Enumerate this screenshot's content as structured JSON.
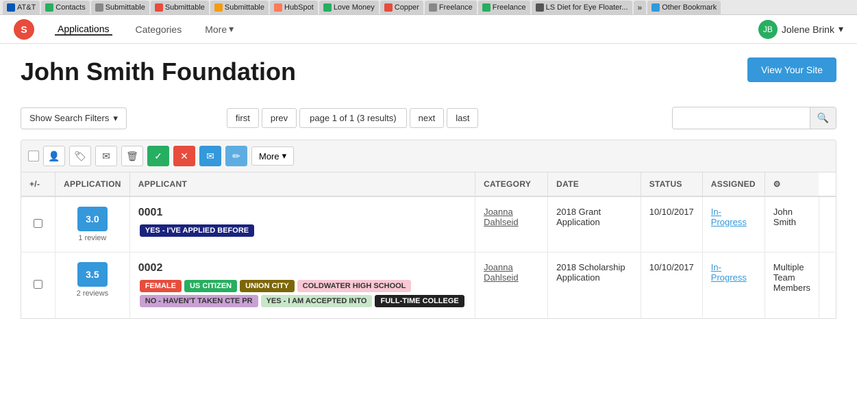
{
  "browser": {
    "tabs": [
      {
        "id": "att",
        "label": "AT&T",
        "icon_color": "#0057b7",
        "icon_char": "A"
      },
      {
        "id": "contacts",
        "label": "Contacts",
        "icon_color": "#27ae60",
        "icon_char": "C"
      },
      {
        "id": "submittable1",
        "label": "Submittable",
        "icon_color": "#888",
        "icon_char": "S"
      },
      {
        "id": "submittable2",
        "label": "Submittable",
        "icon_color": "#e74c3c",
        "icon_char": "S"
      },
      {
        "id": "submittable3",
        "label": "Submittable",
        "icon_color": "#f39c12",
        "icon_char": "S"
      },
      {
        "id": "hubspot",
        "label": "HubSpot",
        "icon_color": "#ff7a59",
        "icon_char": "H"
      },
      {
        "id": "lovemoney",
        "label": "Love Money",
        "icon_color": "#27ae60",
        "icon_char": "L"
      },
      {
        "id": "copper",
        "label": "Copper",
        "icon_color": "#e74c3c",
        "icon_char": "C"
      },
      {
        "id": "freelance1",
        "label": "Freelance",
        "icon_color": "#888",
        "icon_char": "F"
      },
      {
        "id": "freelance2",
        "label": "Freelance",
        "icon_color": "#27ae60",
        "icon_char": "F"
      },
      {
        "id": "diet",
        "label": "LS Diet for Eye Floater...",
        "icon_color": "#555",
        "icon_char": "L"
      },
      {
        "id": "other",
        "label": "Other Bookmark",
        "icon_color": "#3498db",
        "icon_char": "O"
      }
    ],
    "more_tabs_label": "»"
  },
  "nav": {
    "logo_char": "S",
    "links": [
      {
        "id": "applications",
        "label": "Applications",
        "active": true
      },
      {
        "id": "categories",
        "label": "Categories",
        "active": false
      }
    ],
    "more_label": "More",
    "user_name": "Jolene Brink",
    "user_initials": "JB"
  },
  "header": {
    "title": "John Smith Foundation",
    "view_site_btn": "View Your Site"
  },
  "filter_bar": {
    "show_filters_label": "Show Search Filters",
    "pagination": {
      "first": "first",
      "prev": "prev",
      "info": "page 1 of 1 (3 results)",
      "next": "next",
      "last": "last"
    },
    "search_placeholder": ""
  },
  "toolbar": {
    "more_label": "More",
    "chevron": "▾"
  },
  "table": {
    "columns": {
      "adjust": "+/-",
      "application": "APPLICATION",
      "applicant": "APPLICANT",
      "category": "CATEGORY",
      "date": "DATE",
      "status": "STATUS",
      "assigned": "ASSIGNED"
    },
    "rows": [
      {
        "id": "row-0001",
        "score": "3.0",
        "review_count": "1 review",
        "app_number": "0001",
        "applicant": "Joanna Dahlseid",
        "category": "2018 Grant Application",
        "date": "10/10/2017",
        "status": "In-Progress",
        "assigned": "John Smith",
        "tags": [
          {
            "label": "YES - I'VE APPLIED BEFORE",
            "color": "#1a237e"
          }
        ]
      },
      {
        "id": "row-0002",
        "score": "3.5",
        "review_count": "2 reviews",
        "app_number": "0002",
        "applicant": "Joanna Dahlseid",
        "category": "2018 Scholarship Application",
        "date": "10/10/2017",
        "status": "In-Progress",
        "assigned": "Multiple Team Members",
        "tags": [
          {
            "label": "FEMALE",
            "color": "#e74c3c"
          },
          {
            "label": "US CITIZEN",
            "color": "#27ae60"
          },
          {
            "label": "UNION CITY",
            "color": "#7d6608"
          },
          {
            "label": "COLDWATER HIGH SCHOOL",
            "color": "#f8c8d4"
          },
          {
            "label": "NO - HAVEN'T TAKEN CTE PR",
            "color": "#c9a0d4"
          },
          {
            "label": "YES - I AM ACCEPTED INTO",
            "color": "#c8e6c9"
          },
          {
            "label": "FULL-TIME COLLEGE",
            "color": "#222"
          }
        ]
      }
    ]
  }
}
